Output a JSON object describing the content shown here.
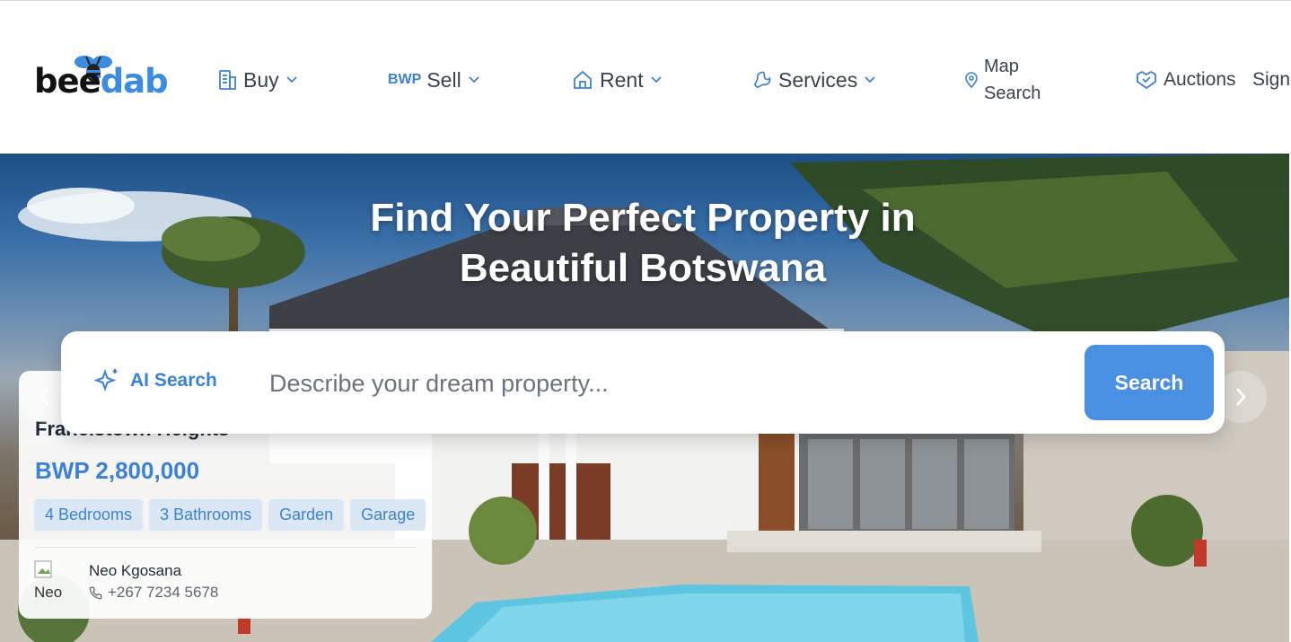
{
  "brand": {
    "logo_part1": "bee",
    "logo_part2": "dab"
  },
  "nav": {
    "buy": "Buy",
    "sell_prefix": "BWP",
    "sell": "Sell",
    "rent": "Rent",
    "services": "Services",
    "map_line1": "Map",
    "map_line2": "Search",
    "auctions": "Auctions",
    "signin": "Sign"
  },
  "hero": {
    "title_line1": "Find Your Perfect Property in",
    "title_line2": "Beautiful Botswana"
  },
  "search": {
    "ai_label": "AI Search",
    "placeholder": "Describe your dream property...",
    "button": "Search"
  },
  "listing": {
    "title": "Francistown Heights",
    "price": "BWP 2,800,000",
    "tags": [
      "4 Bedrooms",
      "3 Bathrooms",
      "Garden",
      "Garage"
    ],
    "agent_name": "Neo Kgosana",
    "agent_phone": "+267 7234 5678",
    "agent_avatar_alt": "Neo"
  },
  "colors": {
    "accent": "#3b82d6",
    "button": "#4a90e2"
  },
  "icons": [
    "building-icon",
    "chevron-down-icon",
    "home-icon",
    "wrench-icon",
    "map-pin-icon",
    "handshake-icon",
    "sparkles-icon",
    "phone-icon",
    "chevron-left-icon",
    "chevron-right-icon",
    "bee-icon"
  ]
}
